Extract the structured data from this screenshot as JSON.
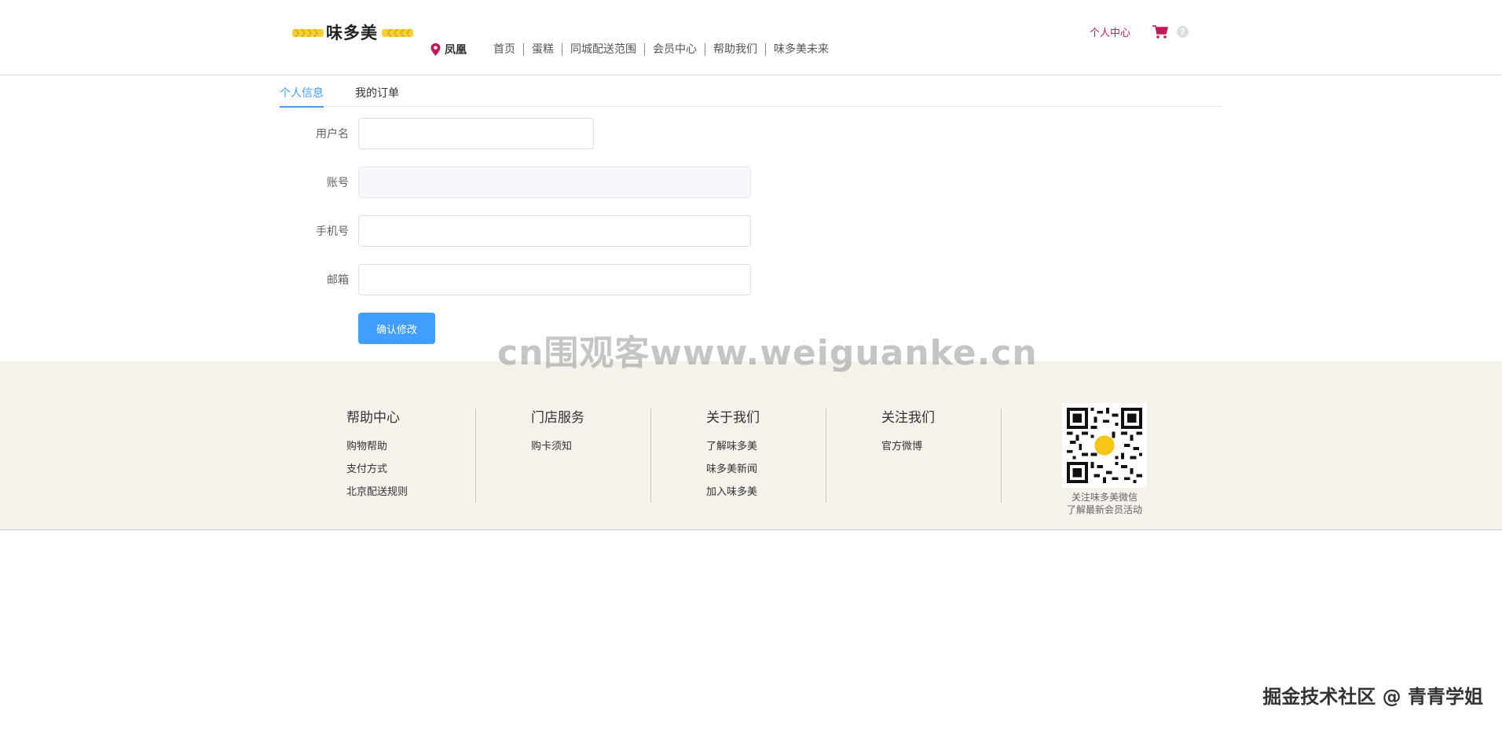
{
  "header": {
    "logo_text": "味多美",
    "location": "凤凰",
    "nav": [
      "首页",
      "蛋糕",
      "同城配送范围",
      "会员中心",
      "帮助我们",
      "味多美未来"
    ],
    "personal_center": "个人中心",
    "help_glyph": "?",
    "cart_icon": "cart-icon",
    "accent_color": "#c2185b"
  },
  "tabs": [
    {
      "label": "个人信息",
      "active": true
    },
    {
      "label": "我的订单",
      "active": false
    }
  ],
  "form": {
    "username_label": "用户名",
    "username_value": "",
    "account_label": "账号",
    "account_value": "",
    "phone_label": "手机号",
    "phone_value": "",
    "email_label": "邮箱",
    "email_value": "",
    "submit_label": "确认修改",
    "primary_color": "#409eff"
  },
  "watermark": "cn围观客www.weiguanke.cn",
  "footer": {
    "columns": [
      {
        "title": "帮助中心",
        "links": [
          "购物帮助",
          "支付方式",
          "北京配送规则"
        ]
      },
      {
        "title": "门店服务",
        "links": [
          "购卡须知"
        ]
      },
      {
        "title": "关于我们",
        "links": [
          "了解味多美",
          "味多美新闻",
          "加入味多美"
        ]
      },
      {
        "title": "关注我们",
        "links": [
          "官方微博"
        ]
      }
    ],
    "qr_caption_line1": "关注味多美微信",
    "qr_caption_line2": "了解最新会员活动",
    "background_color": "#f5f1eb"
  },
  "attribution": "掘金技术社区 @ 青青学姐"
}
